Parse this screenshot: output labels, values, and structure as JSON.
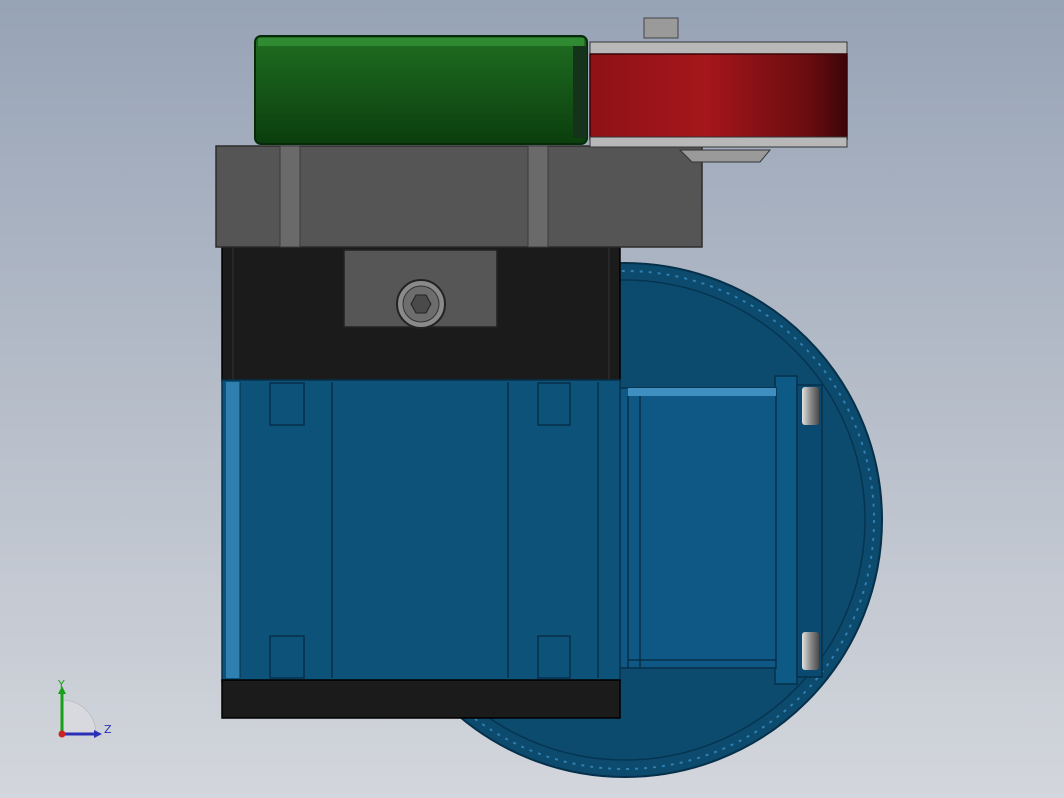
{
  "view": {
    "background_top": "#97a3b6",
    "background_bottom": "#d3d6dc"
  },
  "colors": {
    "motor_blue": "#0d5278",
    "motor_blue_edge": "#06304a",
    "motor_blue_highlight": "#3f8fc0",
    "housing_black": "#1b1b1b",
    "mount_gray": "#555555",
    "bracket_green": "#0f4f12",
    "wheel_red": "#7a0f12",
    "steel": "#b8b8b8"
  },
  "triad": {
    "y_label": "Y",
    "z_label": "Z",
    "y_color": "#18a018",
    "z_color": "#2a2fb8",
    "x_color": "#cc2222"
  }
}
